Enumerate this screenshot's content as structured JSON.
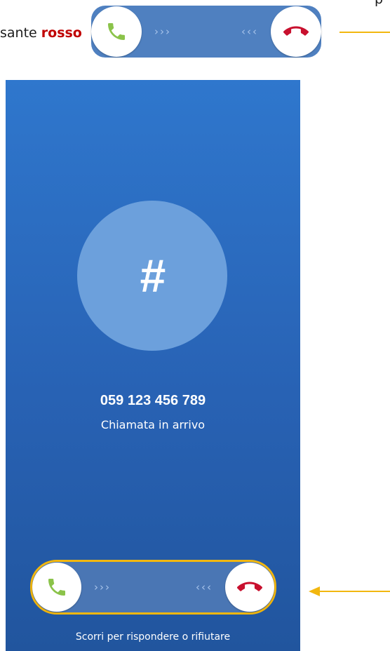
{
  "document": {
    "caption_prefix": "sante ",
    "caption_emphasis": "rosso",
    "top_right_fragment": "p"
  },
  "colors": {
    "accent_red": "#c00000",
    "callout_yellow": "#f2b70f",
    "answer_green": "#8bc34a",
    "decline_red": "#c8102e"
  },
  "top_slider": {
    "answer_icon": "phone-answer-icon",
    "decline_icon": "phone-hangup-icon",
    "right_arrows": "›››",
    "left_arrows": "‹‹‹"
  },
  "call_screen": {
    "avatar_glyph": "#",
    "caller_number": "059 123 456 789",
    "status": "Chiamata in arrivo",
    "slider": {
      "answer_icon": "phone-answer-icon",
      "decline_icon": "phone-hangup-icon",
      "right_arrows": "›››",
      "left_arrows": "‹‹‹"
    },
    "hint": "Scorri per rispondere o rifiutare"
  }
}
